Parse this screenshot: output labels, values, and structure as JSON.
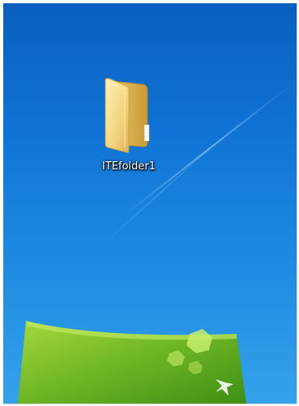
{
  "desktop": {
    "background_color": "#1b88e0",
    "icons": [
      {
        "label": "ITEfolder1",
        "icon": "folder-icon"
      }
    ]
  }
}
